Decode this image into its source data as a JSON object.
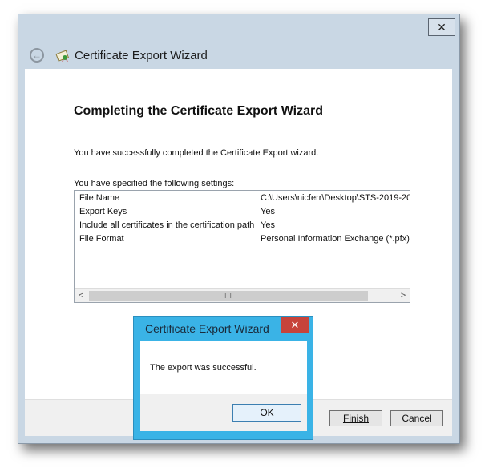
{
  "wizard": {
    "title": "Certificate Export Wizard",
    "close_glyph": "✕",
    "back_glyph": "←",
    "heading": "Completing the Certificate Export Wizard",
    "success_text": "You have successfully completed the Certificate Export wizard.",
    "settings_label": "You have specified the following settings:",
    "settings": [
      {
        "key": "File Name",
        "value": "C:\\Users\\nicferr\\Desktop\\STS-2019-20"
      },
      {
        "key": "Export Keys",
        "value": "Yes"
      },
      {
        "key": "Include all certificates in the certification path",
        "value": "Yes"
      },
      {
        "key": "File Format",
        "value": "Personal Information Exchange (*.pfx)"
      }
    ],
    "scroll_left": "<",
    "scroll_right": ">",
    "scroll_thumb_grip": "III",
    "finish_label": "Finish",
    "cancel_label": "Cancel"
  },
  "dialog": {
    "title": "Certificate Export Wizard",
    "close_glyph": "✕",
    "message": "The export was successful.",
    "ok_label": "OK"
  },
  "colors": {
    "wizard_frame": "#c9d7e4",
    "dialog_frame": "#3ab3e6",
    "dialog_close": "#c7433a"
  },
  "icons": {
    "back": "back-arrow-icon",
    "certificate": "certificate-icon",
    "close": "close-icon"
  }
}
